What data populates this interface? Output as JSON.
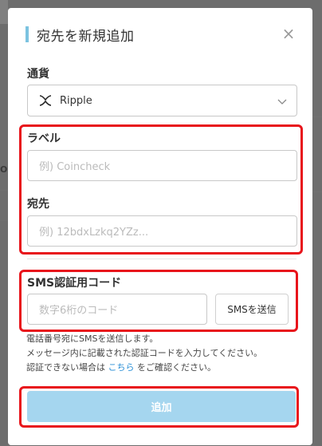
{
  "modal": {
    "title": "宛先を新規追加",
    "close_icon": "×"
  },
  "currency": {
    "label": "通貨",
    "selected": "Ripple",
    "icon": "xrp-icon"
  },
  "label_field": {
    "label": "ラベル",
    "placeholder": "例) Coincheck"
  },
  "address_field": {
    "label": "宛先",
    "placeholder": "例) 12bdxLzkq2YZz..."
  },
  "sms": {
    "label": "SMS認証用コード",
    "placeholder": "数字6桁のコード",
    "send_button": "SMSを送信"
  },
  "notes": {
    "line1": "電話番号宛にSMSを送信します。",
    "line2": "メッセージ内に記載された認証コードを入力してください。",
    "line3_before": "認証できない場合は ",
    "line3_link": "こちら",
    "line3_after": " をご確認ください。"
  },
  "submit": {
    "label": "追加"
  },
  "colors": {
    "accent": "#7cc3e0",
    "button_disabled": "#a5d6ef",
    "highlight": "#e8141b",
    "link": "#2a8fd6"
  }
}
